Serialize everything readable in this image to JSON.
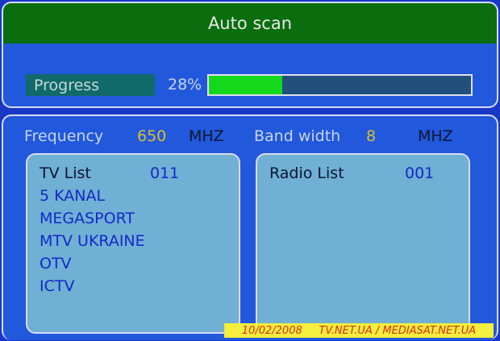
{
  "title": "Auto scan",
  "progress": {
    "label": "Progress",
    "percent_text": "28%",
    "fraction": 0.28
  },
  "frequency": {
    "label": "Frequency",
    "value": "650",
    "unit": "MHZ"
  },
  "bandwidth": {
    "label": "Band width",
    "value": "8",
    "unit": "MHZ"
  },
  "tv_list": {
    "label": "TV List",
    "count": "011",
    "channels": [
      "5 KANAL",
      "MEGASPORT",
      "MTV UKRAINE",
      "OTV",
      "ICTV"
    ]
  },
  "radio_list": {
    "label": "Radio List",
    "count": "001"
  },
  "watermark": "10/02/2008     TV.NET.UA / MEDIASAT.NET.UA",
  "colors": {
    "background": "#1a38c8",
    "panel": "#2158dc",
    "title_bar": "#0a6e0e",
    "progress_fill": "#14d81c",
    "value_yellow": "#d8c030",
    "list_bg": "#6fb0d4",
    "channel_blue": "#1428c8"
  }
}
